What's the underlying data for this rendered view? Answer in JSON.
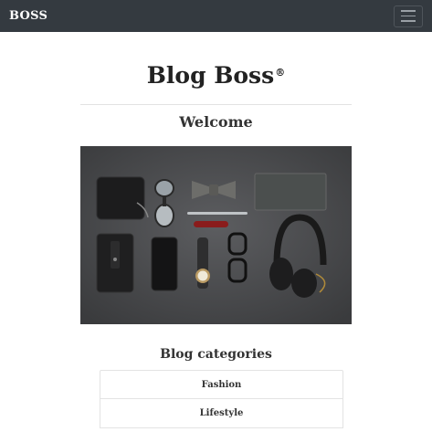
{
  "navbar": {
    "brand": "BOSS"
  },
  "header": {
    "title": "Blog Boss",
    "title_mark": "®",
    "subtitle": "Welcome"
  },
  "hero": {
    "icon": "flatlay-photo"
  },
  "categories": {
    "heading": "Blog categories",
    "items": [
      "Fashion",
      "Lifestyle"
    ]
  },
  "colors": {
    "navbar_bg": "#343a40",
    "hero_bg": "#48494b"
  }
}
